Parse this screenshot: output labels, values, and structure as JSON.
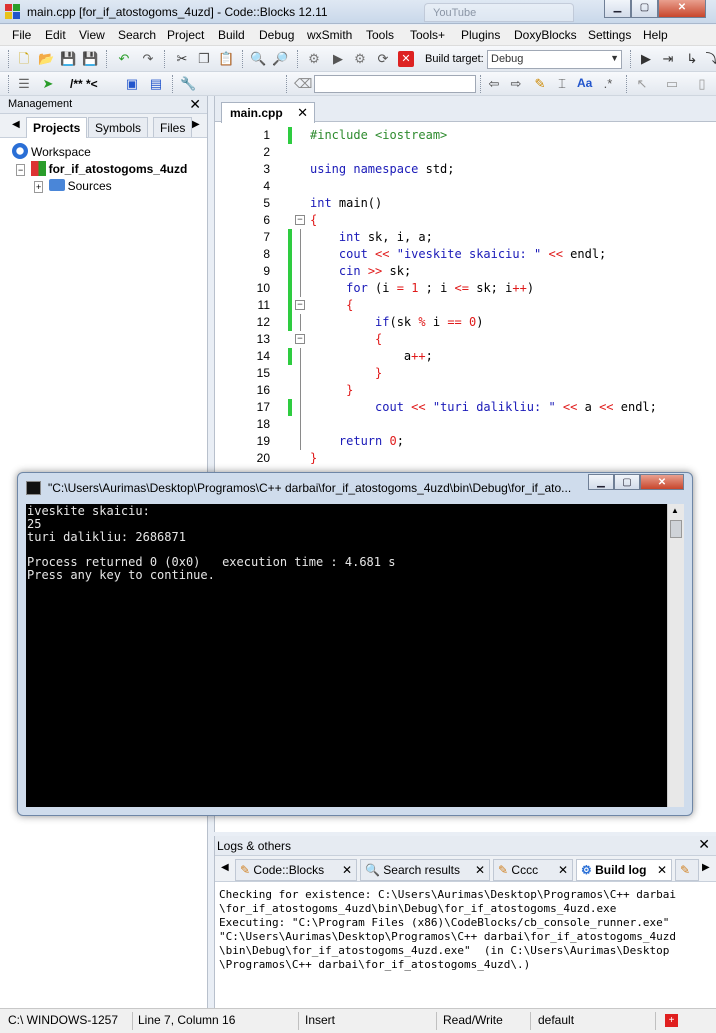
{
  "window": {
    "title": "main.cpp [for_if_atostogoms_4uzd] - Code::Blocks 12.11",
    "background_tab": "YouTube"
  },
  "menu": [
    "File",
    "Edit",
    "View",
    "Search",
    "Project",
    "Build",
    "Debug",
    "wxSmith",
    "Tools",
    "Tools+",
    "Plugins",
    "DoxyBlocks",
    "Settings",
    "Help"
  ],
  "toolbar": {
    "build_target_label": "Build target:",
    "build_target_value": "Debug",
    "doxy_label": "/** *<"
  },
  "management": {
    "title": "Management",
    "tabs": [
      "Projects",
      "Symbols",
      "Files"
    ],
    "tree": {
      "workspace": "Workspace",
      "project": "for_if_atostogoms_4uzd",
      "sources": "Sources"
    }
  },
  "editor": {
    "tab": "main.cpp",
    "lines": [
      {
        "n": "1",
        "html": "<span class=\"pp\">#include &lt;iostream&gt;</span>",
        "mark": true
      },
      {
        "n": "2",
        "html": "",
        "mark": false
      },
      {
        "n": "3",
        "html": "<span class=\"kw\">using namespace</span> std;",
        "mark": false
      },
      {
        "n": "4",
        "html": "",
        "mark": false
      },
      {
        "n": "5",
        "html": "<span class=\"kw\">int</span> main()",
        "mark": false
      },
      {
        "n": "6",
        "html": "<span class=\"op\">{</span>",
        "mark": false
      },
      {
        "n": "7",
        "html": "    <span class=\"kw\">int</span> sk, i, a;",
        "mark": true
      },
      {
        "n": "8",
        "html": "    <span class=\"kw\">cout</span> <span class=\"op\">&lt;&lt;</span> <span class=\"str\">\"iveskite skaiciu: \"</span> <span class=\"op\">&lt;&lt;</span> endl;",
        "mark": true
      },
      {
        "n": "9",
        "html": "    <span class=\"kw\">cin</span> <span class=\"op\">&gt;&gt;</span> sk;",
        "mark": true
      },
      {
        "n": "10",
        "html": "     <span class=\"kw\">for</span> (i <span class=\"op\">=</span> <span class=\"num\">1</span> ; i <span class=\"op\">&lt;=</span> sk; i<span class=\"op\">++</span>)",
        "mark": true
      },
      {
        "n": "11",
        "html": "     <span class=\"op\">{</span>",
        "mark": true
      },
      {
        "n": "12",
        "html": "         <span class=\"kw\">if</span>(sk <span class=\"op\">%</span> i <span class=\"op\">==</span> <span class=\"num\">0</span>)",
        "mark": true
      },
      {
        "n": "13",
        "html": "         <span class=\"op\">{</span>",
        "mark": false
      },
      {
        "n": "14",
        "html": "             a<span class=\"op\">++</span>;",
        "mark": true
      },
      {
        "n": "15",
        "html": "         <span class=\"op\">}</span>",
        "mark": false
      },
      {
        "n": "16",
        "html": "     <span class=\"op\">}</span>",
        "mark": false
      },
      {
        "n": "17",
        "html": "         <span class=\"kw\">cout</span> <span class=\"op\">&lt;&lt;</span> <span class=\"str\">\"turi dalikliu: \"</span> <span class=\"op\">&lt;&lt;</span> a <span class=\"op\">&lt;&lt;</span> endl;",
        "mark": true
      },
      {
        "n": "18",
        "html": "",
        "mark": false
      },
      {
        "n": "19",
        "html": "    <span class=\"kw\">return</span> <span class=\"num\">0</span>;",
        "mark": false
      },
      {
        "n": "20",
        "html": "<span class=\"op\">}</span>",
        "mark": false
      }
    ]
  },
  "console": {
    "title": "\"C:\\Users\\Aurimas\\Desktop\\Programos\\C++ darbai\\for_if_atostogoms_4uzd\\bin\\Debug\\for_if_ato...",
    "output": "iveskite skaiciu:\n25\nturi dalikliu: 2686871\n\nProcess returned 0 (0x0)   execution time : 4.681 s\nPress any key to continue."
  },
  "logs": {
    "title": "Logs & others",
    "tabs": [
      "Code::Blocks",
      "Search results",
      "Cccc",
      "Build log"
    ],
    "text": "Checking for existence: C:\\Users\\Aurimas\\Desktop\\Programos\\C++ darbai\n\\for_if_atostogoms_4uzd\\bin\\Debug\\for_if_atostogoms_4uzd.exe\nExecuting: \"C:\\Program Files (x86)\\CodeBlocks/cb_console_runner.exe\"\n\"C:\\Users\\Aurimas\\Desktop\\Programos\\C++ darbai\\for_if_atostogoms_4uzd\n\\bin\\Debug\\for_if_atostogoms_4uzd.exe\"  (in C:\\Users\\Aurimas\\Desktop\n\\Programos\\C++ darbai\\for_if_atostogoms_4uzd\\.)"
  },
  "status": {
    "encoding": "C:\\ WINDOWS-1257",
    "position": "Line 7, Column 16",
    "mode": "Insert",
    "access": "Read/Write",
    "lang": "default"
  }
}
